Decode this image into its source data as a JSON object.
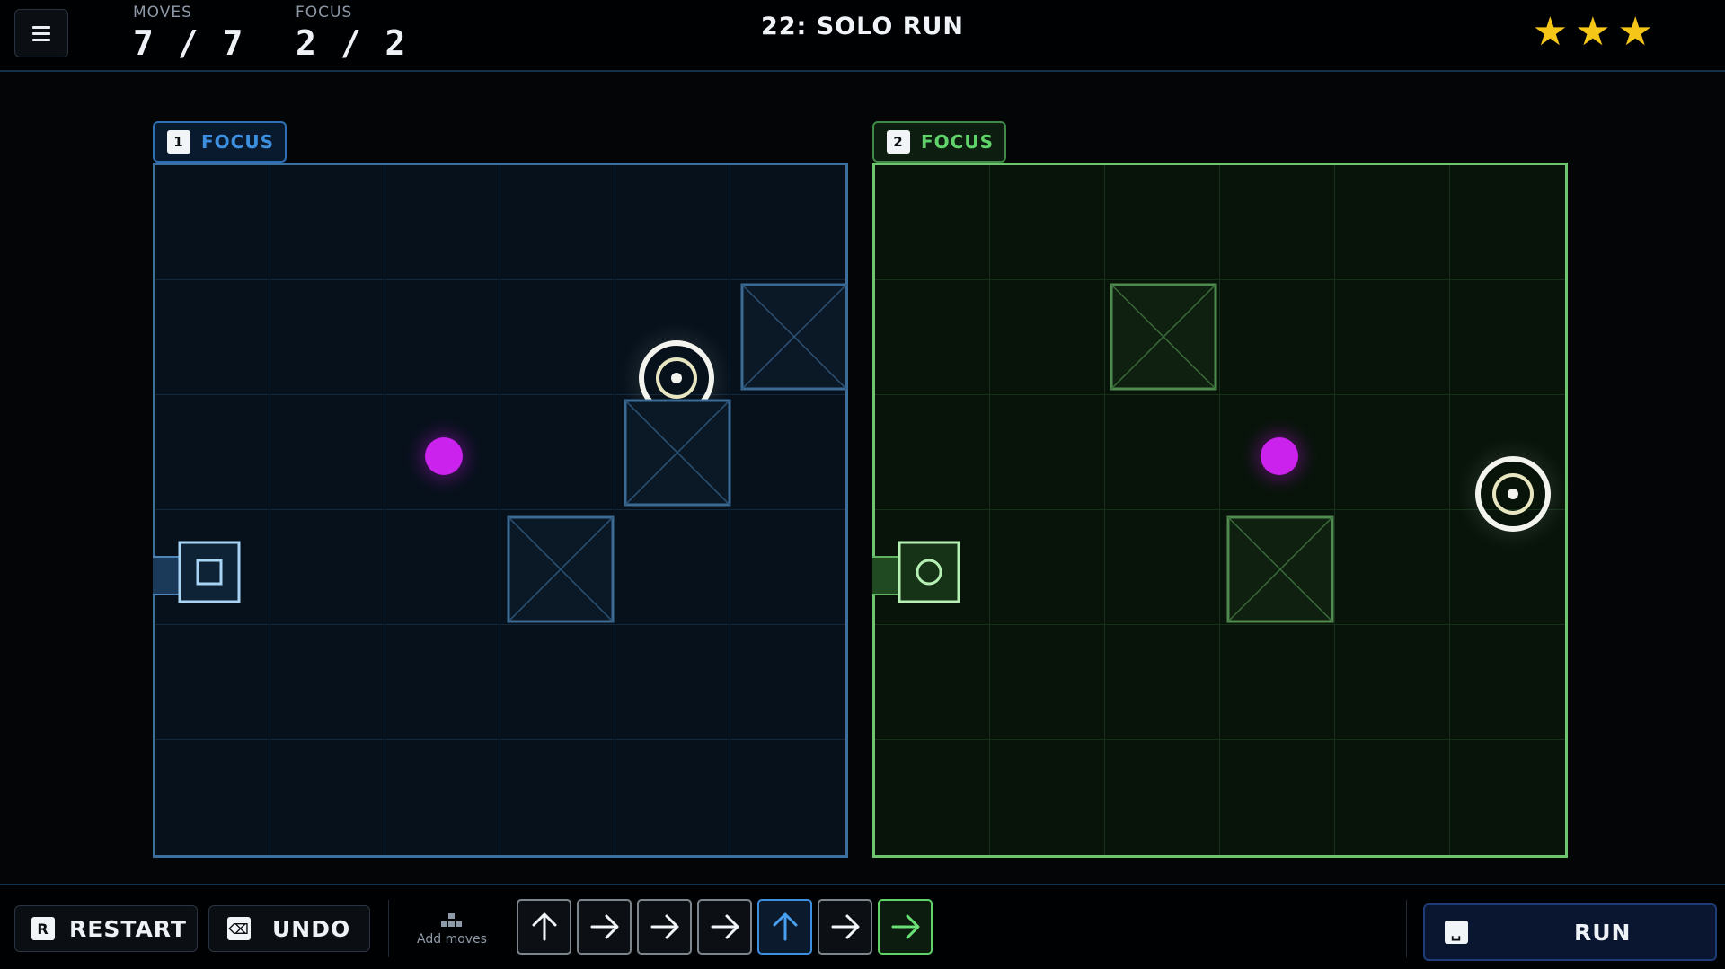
{
  "header": {
    "menu_icon": "hamburger-icon",
    "moves_label": "MOVES",
    "moves_value": "7 / 7",
    "focus_label": "FOCUS",
    "focus_value": "2 / 2",
    "level_title": "22: SOLO RUN",
    "stars": 3
  },
  "boards": [
    {
      "index": "1",
      "label": "FOCUS",
      "color": "#3d8fe0",
      "grid_size": 6
    },
    {
      "index": "2",
      "label": "FOCUS",
      "color": "#5fd36a",
      "grid_size": 6
    }
  ],
  "footer": {
    "restart_key": "R",
    "restart_label": "RESTART",
    "undo_key": "⌫",
    "undo_label": "UNDO",
    "add_moves_label": "Add moves",
    "moves": [
      {
        "dir": "up",
        "active": "none"
      },
      {
        "dir": "right",
        "active": "none"
      },
      {
        "dir": "right",
        "active": "none"
      },
      {
        "dir": "right",
        "active": "none"
      },
      {
        "dir": "up",
        "active": "blue"
      },
      {
        "dir": "right",
        "active": "none"
      },
      {
        "dir": "right",
        "active": "green"
      }
    ],
    "run_key": "␣",
    "run_label": "RUN"
  },
  "colors": {
    "accent_blue": "#3d8fe0",
    "accent_green": "#5fd36a",
    "star": "#f5c518",
    "collectible": "#cc22ee"
  }
}
